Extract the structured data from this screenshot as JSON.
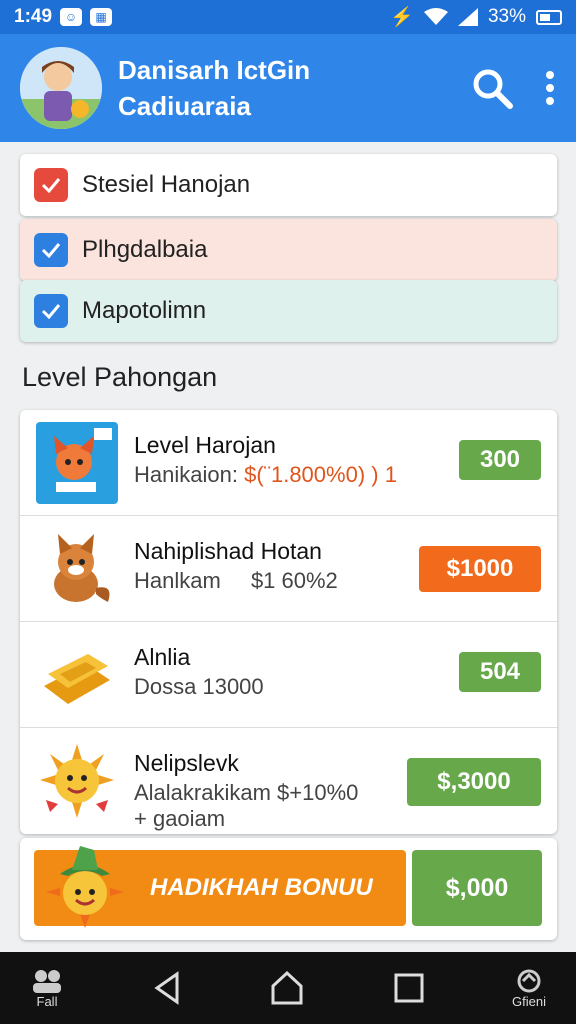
{
  "status_bar": {
    "time": "1:49",
    "battery_text": "33%",
    "icons": [
      "message-icon",
      "image-icon",
      "vibrate-icon",
      "wifi-icon",
      "signal-icon",
      "battery-icon"
    ]
  },
  "app_bar": {
    "title_line1": "Danisarh IctGin",
    "title_line2": "Cadiuaraia",
    "icons": [
      "avatar",
      "search-icon",
      "more-vert-icon"
    ]
  },
  "tasks": [
    {
      "label": "Stesiel Hanojan",
      "check_color": "#e64a3c",
      "bg": "#ffffff"
    },
    {
      "label": "Plhgdalbaia",
      "check_color": "#2d7fe0",
      "bg": "#fbe4de"
    },
    {
      "label": "Mapotolimn",
      "check_color": "#2d7fe0",
      "bg": "#dff1ec"
    }
  ],
  "section": {
    "title": "Level Pahongan"
  },
  "levels": [
    {
      "name": "Level Harojan",
      "sub_prefix": "Hanikaion:",
      "sub_value": "$(¨1.800%0) ) 1",
      "price": "300",
      "price_color": "#67a94a",
      "thumb": "fox-card-icon"
    },
    {
      "name": "Nahiplishad Hotan",
      "sub_prefix": "Hanlkam",
      "sub_value": "$1 60%2",
      "price": "$1000",
      "price_color": "#f26a1b",
      "thumb": "fox-icon"
    },
    {
      "name": "Alnlia",
      "sub_prefix": "Dossa 13000",
      "sub_value": "",
      "price": "504",
      "price_color": "#67a94a",
      "thumb": "gold-bars-icon"
    },
    {
      "name": "Nelipslevk",
      "sub_prefix": "Alalakrakikam $+10%0",
      "sub_value": "",
      "sub2": "+ gaoiam",
      "price": "$,3000",
      "price_color": "#67a94a",
      "thumb": "sun-mascot-icon"
    }
  ],
  "bonus": {
    "label": "HADIKHAH BONUU",
    "price": "$,000",
    "mascot": "sun-hat-mascot-icon"
  },
  "nav": [
    {
      "label": "Fall",
      "icon": "people-icon"
    },
    {
      "label": "",
      "icon": "back-icon"
    },
    {
      "label": "",
      "icon": "home-icon"
    },
    {
      "label": "",
      "icon": "recents-icon"
    },
    {
      "label": "Gfieni",
      "icon": "gift-icon"
    }
  ]
}
